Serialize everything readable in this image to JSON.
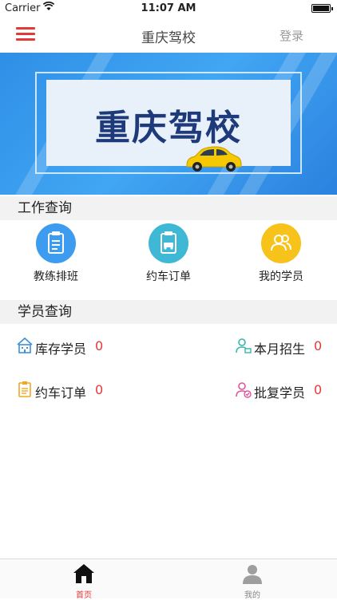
{
  "status_bar": {
    "carrier": "Carrier",
    "time": "11:07 AM"
  },
  "nav": {
    "title": "重庆驾校",
    "login": "登录"
  },
  "banner": {
    "title": "重庆驾校"
  },
  "work_section": {
    "header": "工作查询",
    "items": [
      {
        "label": "教练排班",
        "color": "#3d9cf0",
        "icon": "clipboard-icon"
      },
      {
        "label": "约车订单",
        "color": "#3fb8d6",
        "icon": "car-order-icon"
      },
      {
        "label": "我的学员",
        "color": "#f7c21a",
        "icon": "students-icon"
      }
    ]
  },
  "student_section": {
    "header": "学员查询",
    "items": [
      {
        "label": "库存学员",
        "value": "0",
        "icon": "building-icon",
        "color": "#3d8fd8"
      },
      {
        "label": "本月招生",
        "value": "0",
        "icon": "user-add-icon",
        "color": "#38b7a8"
      },
      {
        "label": "约车订单",
        "value": "0",
        "icon": "list-icon",
        "color": "#f2a623"
      },
      {
        "label": "批复学员",
        "value": "0",
        "icon": "user-check-icon",
        "color": "#e0559a"
      }
    ]
  },
  "tabs": [
    {
      "label": "首页",
      "active": true,
      "color": "#e53935"
    },
    {
      "label": "我的",
      "active": false,
      "color": "#888888"
    }
  ]
}
